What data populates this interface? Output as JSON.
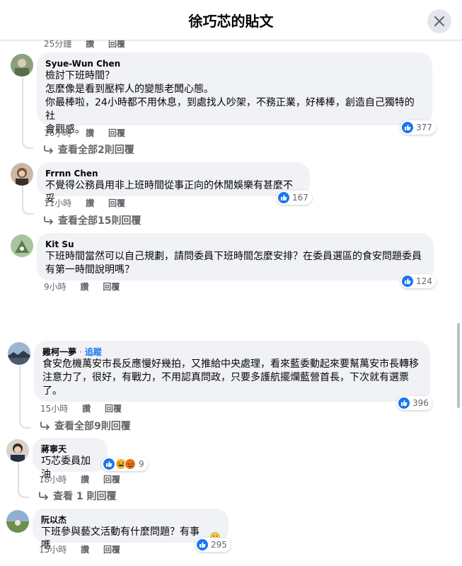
{
  "header": {
    "title": "徐巧芯的貼文"
  },
  "top_row": {
    "time": "25分鐘",
    "like": "讚",
    "reply": "回覆"
  },
  "comments": [
    {
      "author": "Syue-Wun Chen",
      "lines": [
        "檢討下班時間？",
        "怎麼像是看到壓榨人的變態老闆心態。",
        "你最棒啦，24小時都不用休息，到處找人吵架，不務正業，好棒棒，創造自己獨特的社",
        "會觀感。"
      ],
      "time": "16小時",
      "like": "讚",
      "reply": "回覆",
      "reaction_count": "377",
      "view_replies": "查看全部2則回覆"
    },
    {
      "author": "Frrnn Chen",
      "lines": [
        "不覺得公務員用非上班時間從事正向的休閒娛樂有甚麼不妥"
      ],
      "time": "11小時",
      "like": "讚",
      "reply": "回覆",
      "reaction_count": "167",
      "view_replies": "查看全部15則回覆"
    },
    {
      "author": "Kit Su",
      "lines": [
        "下班時間當然可以自己規劃，請問委員下班時間怎麼安排？在委員選區的食安問題委員",
        "有第一時間說明嗎？"
      ],
      "time": "9小時",
      "like": "讚",
      "reply": "回覆",
      "reaction_count": "124"
    },
    {
      "author": "雞柯一夢",
      "follow": "追蹤",
      "lines": [
        "食安危機萬安市長反應慢好幾拍，又推給中央處理，看來藍委動起來要幫萬安市長轉移",
        "注意力了，很好，有戰力，不用認真問政，只要多護航擺爛藍營首長，下次就有選票",
        "了。"
      ],
      "time": "15小時",
      "like": "讚",
      "reply": "回覆",
      "reaction_count": "396",
      "view_replies": "查看全部9則回覆"
    },
    {
      "author": "蔣寧天",
      "lines": [
        "巧芯委員加油"
      ],
      "time": "18小時",
      "like": "讚",
      "reply": "回覆",
      "reaction_count": "9",
      "view_replies": "查看 1 則回覆"
    },
    {
      "author": "阮以杰",
      "lines": [
        "下班參與藝文活動有什麼問題？有事嗎"
      ],
      "time": "15小時",
      "like": "讚",
      "reply": "回覆",
      "reaction_count": "295"
    }
  ],
  "colors": {
    "like_blue": "#1877f2",
    "bubble_bg": "#f0f2f5",
    "secondary_text": "#65676b",
    "haha_yellow": "#f7b125",
    "angry_red": "#e9710f"
  },
  "icons": {
    "close": "close-icon",
    "like": "thumbs-up-icon",
    "reply_arrow": "reply-arrow-icon",
    "haha": "haha-emoji-icon",
    "angry": "angry-emoji-icon",
    "smile": "smiling-emoji-icon"
  }
}
